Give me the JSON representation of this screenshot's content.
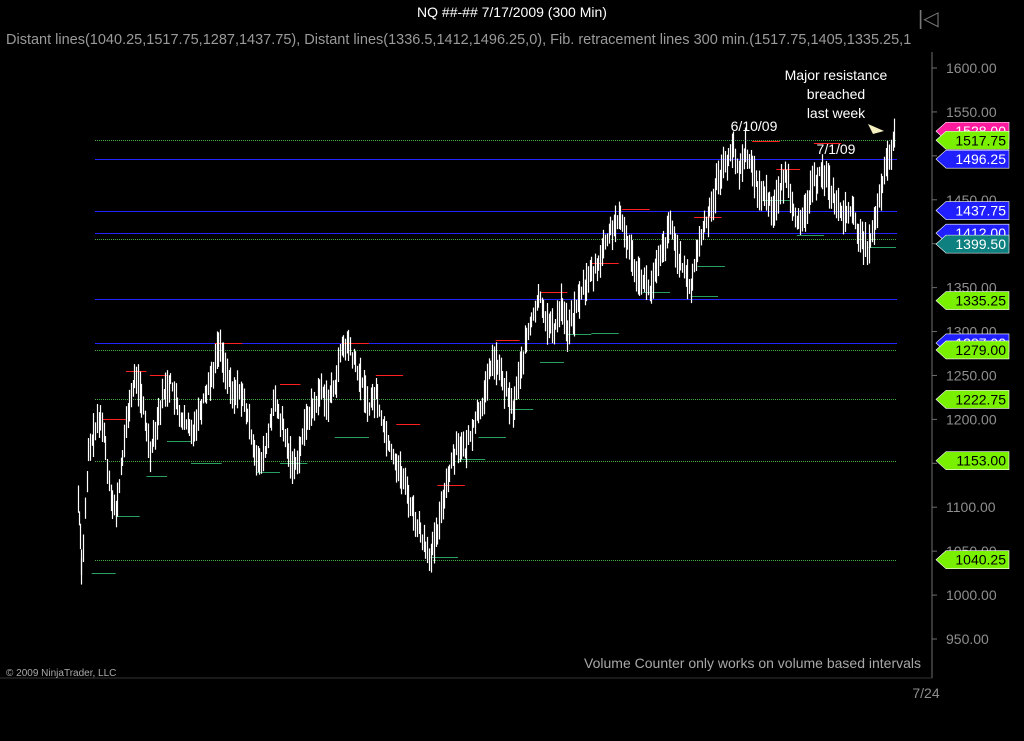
{
  "window": {
    "title": "NQ ##-##  7/17/2009 (300 Min)",
    "nav_arrow": "|◁"
  },
  "indicator_text": "Distant lines(1040.25,1517.75,1287,1437.75), Distant lines(1336.5,1412,1496.25,0), Fib. retracement lines 300 min.(1517.75,1405,1335.25,1",
  "copyright": "© 2009 NinjaTrader, LLC",
  "volume_message": "Volume Counter only works on volume based intervals",
  "colors": {
    "background": "#000000",
    "blue_line": "#2424ff",
    "green_line": "#43a843",
    "pink_tag": "#ff1a9e",
    "blue_tag": "#1f1fff",
    "green_tag": "#78f000",
    "teal_tag": "#0e8080",
    "price_bars": "#ffffff",
    "swing_high": "#ff2020",
    "swing_low": "#2aa060"
  },
  "chart_data": {
    "type": "line",
    "x_label": "7/24",
    "ylim": [
      920,
      1630
    ],
    "y_ticks": [
      "1600.00",
      "1550.00",
      "1500.00",
      "1450.00",
      "1400.00",
      "1350.00",
      "1300.00",
      "1250.00",
      "1200.00",
      "1150.00",
      "1100.00",
      "1050.00",
      "1000.00",
      "950.00"
    ],
    "horizontal_lines": [
      {
        "price": 1517.75,
        "style": "dotted",
        "color": "green"
      },
      {
        "price": 1496.25,
        "style": "solid",
        "color": "blue"
      },
      {
        "price": 1437.75,
        "style": "solid",
        "color": "blue"
      },
      {
        "price": 1412.0,
        "style": "solid",
        "color": "blue"
      },
      {
        "price": 1405.0,
        "style": "dotted",
        "color": "green"
      },
      {
        "price": 1336.5,
        "style": "solid",
        "color": "blue"
      },
      {
        "price": 1287.0,
        "style": "solid",
        "color": "blue"
      },
      {
        "price": 1279.0,
        "style": "dotted",
        "color": "green"
      },
      {
        "price": 1222.75,
        "style": "dotted",
        "color": "green"
      },
      {
        "price": 1153.0,
        "style": "dotted",
        "color": "green"
      },
      {
        "price": 1040.25,
        "style": "dotted",
        "color": "green"
      }
    ],
    "price_tags": [
      {
        "label": "1528.00",
        "price": 1528.0,
        "color": "pink"
      },
      {
        "label": "1517.75",
        "price": 1517.75,
        "color": "green"
      },
      {
        "label": "1496.25",
        "price": 1496.25,
        "color": "blue"
      },
      {
        "label": "1437.75",
        "price": 1437.75,
        "color": "blue"
      },
      {
        "label": "1412.00",
        "price": 1412.0,
        "color": "blue"
      },
      {
        "label": "1399.50",
        "price": 1399.5,
        "color": "teal"
      },
      {
        "label": "1335.25",
        "price": 1335.25,
        "color": "green"
      },
      {
        "label": "1287.00",
        "price": 1287.0,
        "color": "blue"
      },
      {
        "label": "1279.00",
        "price": 1279.0,
        "color": "green"
      },
      {
        "label": "1222.75",
        "price": 1222.75,
        "color": "green"
      },
      {
        "label": "1153.00",
        "price": 1153.0,
        "color": "green"
      },
      {
        "label": "1040.25",
        "price": 1040.25,
        "color": "green"
      }
    ],
    "annotations": [
      {
        "id": "resistance",
        "lines": [
          "Major resistance",
          "breached",
          "last week"
        ]
      },
      {
        "id": "date1",
        "lines": [
          "6/10/09"
        ]
      },
      {
        "id": "date2",
        "lines": [
          "7/1/09"
        ]
      }
    ],
    "price_path": [
      [
        0,
        1110
      ],
      [
        2,
        1025
      ],
      [
        6,
        1160
      ],
      [
        10,
        1190
      ],
      [
        14,
        1200
      ],
      [
        18,
        1130
      ],
      [
        22,
        1090
      ],
      [
        26,
        1160
      ],
      [
        30,
        1220
      ],
      [
        34,
        1250
      ],
      [
        38,
        1210
      ],
      [
        42,
        1165
      ],
      [
        46,
        1200
      ],
      [
        50,
        1230
      ],
      [
        54,
        1245
      ],
      [
        58,
        1210
      ],
      [
        62,
        1195
      ],
      [
        66,
        1185
      ],
      [
        70,
        1205
      ],
      [
        74,
        1230
      ],
      [
        78,
        1250
      ],
      [
        82,
        1285
      ],
      [
        86,
        1260
      ],
      [
        90,
        1225
      ],
      [
        94,
        1235
      ],
      [
        98,
        1210
      ],
      [
        102,
        1175
      ],
      [
        106,
        1145
      ],
      [
        110,
        1170
      ],
      [
        114,
        1220
      ],
      [
        118,
        1200
      ],
      [
        122,
        1170
      ],
      [
        126,
        1145
      ],
      [
        130,
        1170
      ],
      [
        134,
        1205
      ],
      [
        138,
        1215
      ],
      [
        142,
        1235
      ],
      [
        146,
        1220
      ],
      [
        150,
        1240
      ],
      [
        154,
        1280
      ],
      [
        158,
        1285
      ],
      [
        162,
        1260
      ],
      [
        166,
        1240
      ],
      [
        170,
        1215
      ],
      [
        174,
        1230
      ],
      [
        178,
        1195
      ],
      [
        182,
        1170
      ],
      [
        186,
        1150
      ],
      [
        190,
        1130
      ],
      [
        194,
        1105
      ],
      [
        198,
        1080
      ],
      [
        202,
        1060
      ],
      [
        206,
        1045
      ],
      [
        210,
        1070
      ],
      [
        214,
        1120
      ],
      [
        218,
        1150
      ],
      [
        222,
        1175
      ],
      [
        226,
        1160
      ],
      [
        230,
        1190
      ],
      [
        234,
        1210
      ],
      [
        238,
        1230
      ],
      [
        242,
        1270
      ],
      [
        246,
        1255
      ],
      [
        250,
        1230
      ],
      [
        254,
        1210
      ],
      [
        258,
        1255
      ],
      [
        262,
        1290
      ],
      [
        266,
        1320
      ],
      [
        270,
        1340
      ],
      [
        274,
        1310
      ],
      [
        278,
        1300
      ],
      [
        282,
        1335
      ],
      [
        286,
        1300
      ],
      [
        290,
        1320
      ],
      [
        294,
        1345
      ],
      [
        298,
        1360
      ],
      [
        302,
        1370
      ],
      [
        306,
        1390
      ],
      [
        310,
        1410
      ],
      [
        314,
        1425
      ],
      [
        318,
        1420
      ],
      [
        322,
        1395
      ],
      [
        326,
        1370
      ],
      [
        330,
        1360
      ],
      [
        334,
        1345
      ],
      [
        338,
        1370
      ],
      [
        342,
        1395
      ],
      [
        346,
        1420
      ],
      [
        350,
        1390
      ],
      [
        354,
        1365
      ],
      [
        358,
        1350
      ],
      [
        362,
        1395
      ],
      [
        366,
        1420
      ],
      [
        370,
        1445
      ],
      [
        374,
        1475
      ],
      [
        378,
        1490
      ],
      [
        382,
        1510
      ],
      [
        386,
        1480
      ],
      [
        390,
        1510
      ],
      [
        394,
        1480
      ],
      [
        398,
        1460
      ],
      [
        402,
        1455
      ],
      [
        406,
        1440
      ],
      [
        410,
        1460
      ],
      [
        414,
        1480
      ],
      [
        418,
        1440
      ],
      [
        422,
        1415
      ],
      [
        426,
        1445
      ],
      [
        430,
        1470
      ],
      [
        434,
        1485
      ],
      [
        438,
        1470
      ],
      [
        442,
        1450
      ],
      [
        446,
        1430
      ],
      [
        450,
        1440
      ],
      [
        454,
        1425
      ],
      [
        458,
        1400
      ],
      [
        462,
        1398
      ],
      [
        466,
        1425
      ],
      [
        470,
        1470
      ],
      [
        474,
        1500
      ],
      [
        478,
        1525
      ]
    ],
    "swing_levels": [
      {
        "x1": 14,
        "x2": 28,
        "price": 1200,
        "kind": "high"
      },
      {
        "x1": 28,
        "x2": 40,
        "price": 1255,
        "kind": "high"
      },
      {
        "x1": 42,
        "x2": 52,
        "price": 1250,
        "kind": "high"
      },
      {
        "x1": 80,
        "x2": 96,
        "price": 1287,
        "kind": "high"
      },
      {
        "x1": 118,
        "x2": 130,
        "price": 1240,
        "kind": "high"
      },
      {
        "x1": 154,
        "x2": 170,
        "price": 1287,
        "kind": "high"
      },
      {
        "x1": 174,
        "x2": 190,
        "price": 1250,
        "kind": "high"
      },
      {
        "x1": 186,
        "x2": 200,
        "price": 1195,
        "kind": "high"
      },
      {
        "x1": 210,
        "x2": 226,
        "price": 1125,
        "kind": "high"
      },
      {
        "x1": 244,
        "x2": 258,
        "price": 1290,
        "kind": "high"
      },
      {
        "x1": 270,
        "x2": 286,
        "price": 1345,
        "kind": "high"
      },
      {
        "x1": 300,
        "x2": 316,
        "price": 1378,
        "kind": "high"
      },
      {
        "x1": 318,
        "x2": 334,
        "price": 1440,
        "kind": "high"
      },
      {
        "x1": 360,
        "x2": 376,
        "price": 1430,
        "kind": "high"
      },
      {
        "x1": 394,
        "x2": 410,
        "price": 1517,
        "kind": "high"
      },
      {
        "x1": 408,
        "x2": 422,
        "price": 1485,
        "kind": "high"
      },
      {
        "x1": 430,
        "x2": 446,
        "price": 1515,
        "kind": "high"
      },
      {
        "x1": 8,
        "x2": 22,
        "price": 1025,
        "kind": "low"
      },
      {
        "x1": 22,
        "x2": 36,
        "price": 1090,
        "kind": "low"
      },
      {
        "x1": 40,
        "x2": 52,
        "price": 1135,
        "kind": "low"
      },
      {
        "x1": 52,
        "x2": 66,
        "price": 1175,
        "kind": "low"
      },
      {
        "x1": 66,
        "x2": 84,
        "price": 1150,
        "kind": "low"
      },
      {
        "x1": 104,
        "x2": 118,
        "price": 1140,
        "kind": "low"
      },
      {
        "x1": 118,
        "x2": 134,
        "price": 1150,
        "kind": "low"
      },
      {
        "x1": 150,
        "x2": 170,
        "price": 1180,
        "kind": "low"
      },
      {
        "x1": 206,
        "x2": 222,
        "price": 1043,
        "kind": "low"
      },
      {
        "x1": 222,
        "x2": 238,
        "price": 1155,
        "kind": "low"
      },
      {
        "x1": 234,
        "x2": 250,
        "price": 1180,
        "kind": "low"
      },
      {
        "x1": 252,
        "x2": 266,
        "price": 1212,
        "kind": "low"
      },
      {
        "x1": 270,
        "x2": 284,
        "price": 1265,
        "kind": "low"
      },
      {
        "x1": 286,
        "x2": 300,
        "price": 1297,
        "kind": "low"
      },
      {
        "x1": 300,
        "x2": 316,
        "price": 1298,
        "kind": "low"
      },
      {
        "x1": 330,
        "x2": 346,
        "price": 1345,
        "kind": "low"
      },
      {
        "x1": 358,
        "x2": 374,
        "price": 1340,
        "kind": "low"
      },
      {
        "x1": 362,
        "x2": 378,
        "price": 1375,
        "kind": "low"
      },
      {
        "x1": 400,
        "x2": 416,
        "price": 1450,
        "kind": "low"
      },
      {
        "x1": 420,
        "x2": 436,
        "price": 1410,
        "kind": "low"
      },
      {
        "x1": 462,
        "x2": 478,
        "price": 1396,
        "kind": "low"
      }
    ]
  }
}
